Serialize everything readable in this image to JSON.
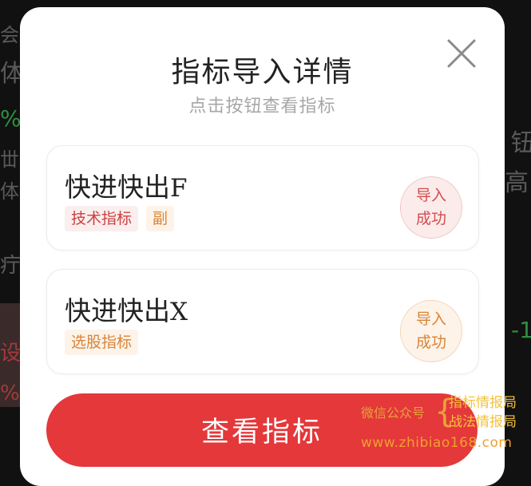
{
  "modal": {
    "title": "指标导入详情",
    "subtitle": "点击按钮查看指标",
    "close_icon": "close-icon",
    "items": [
      {
        "name_cn": "快进快出",
        "name_suffix": "F",
        "tags": [
          "技术指标",
          "副"
        ],
        "status_line1": "导入",
        "status_line2": "成功"
      },
      {
        "name_cn": "快进快出",
        "name_suffix": "X",
        "tags": [
          "选股指标"
        ],
        "status_line1": "导入",
        "status_line2": "成功"
      }
    ],
    "view_button": "查看指标"
  },
  "watermark": {
    "label": "微信公众号",
    "line1": "指标情报局",
    "line2": "战法情报局",
    "url": "www.zhibiao168.com"
  },
  "colors": {
    "accent_red": "#e4383a",
    "tag_orange": "#d9843a",
    "watermark_gold": "#f4c23a"
  }
}
